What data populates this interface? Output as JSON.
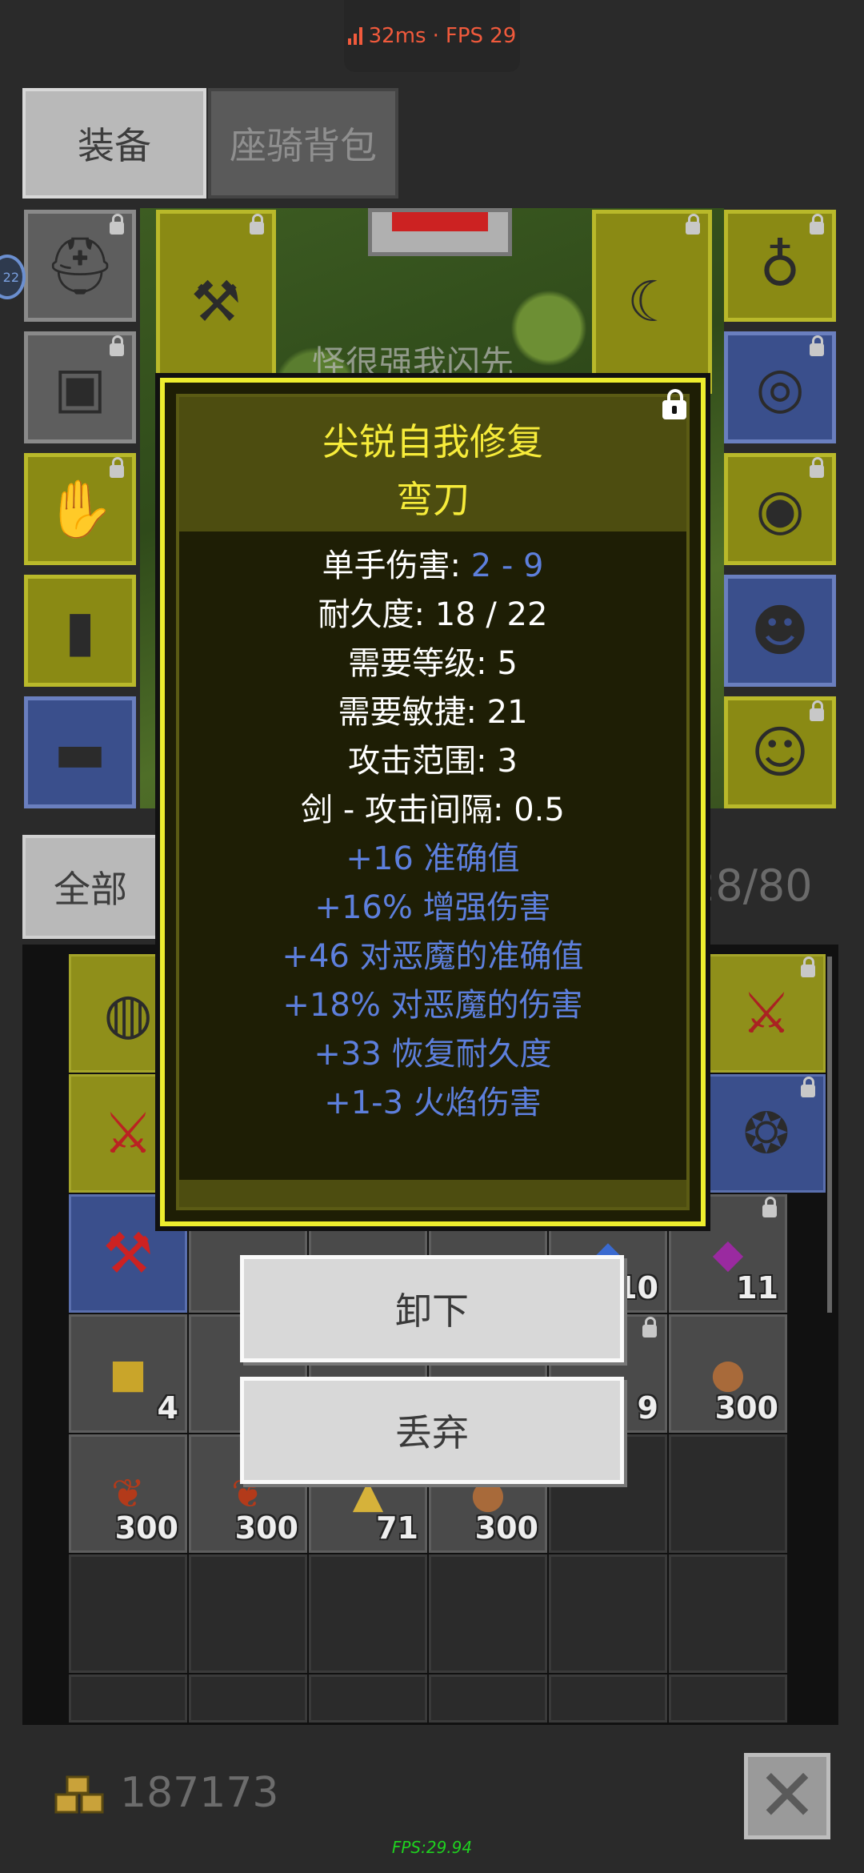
{
  "status_bar": {
    "latency": "32ms",
    "separator": "·",
    "fps": "FPS 29"
  },
  "tabs": {
    "equipment": "装备",
    "mount_bag": "座骑背包"
  },
  "scene": {
    "banner_text": "怪很强我闪先"
  },
  "side_badge": "22",
  "filter": {
    "all_label": "全部",
    "capacity": "28/80"
  },
  "tooltip": {
    "title": "尖锐自我修复",
    "subtitle": "弯刀",
    "stats": [
      {
        "label": "单手伤害: ",
        "value": "2 - 9"
      },
      {
        "label": "耐久度: 18 / 22"
      },
      {
        "label": "需要等级: 5"
      },
      {
        "label": "需要敏捷: 21"
      },
      {
        "label": "攻击范围: 3"
      },
      {
        "label": "剑 - 攻击间隔: 0.5"
      }
    ],
    "bonuses": [
      "+16 准确值",
      "+16% 增强伤害",
      "+46 对恶魔的准确值",
      "+18% 对恶魔的伤害",
      "+33 恢复耐久度",
      "+1-3 火焰伤害"
    ]
  },
  "actions": {
    "unequip": "卸下",
    "discard": "丢弃"
  },
  "bag_quantities": {
    "r3c5": "10",
    "r3c6": "11",
    "r4c1": "4",
    "r4c5": "9",
    "r4c6": "300",
    "r5c1": "300",
    "r5c2": "300",
    "r5c3": "71",
    "r5c4": "300"
  },
  "gold": "187173",
  "close_symbol": "✕",
  "fps_footer": "FPS:29.94",
  "colors": {
    "highlight_yellow": "#f7ec3a",
    "magic_blue": "#5d7fdc",
    "tooltip_border": "#eded2e"
  }
}
